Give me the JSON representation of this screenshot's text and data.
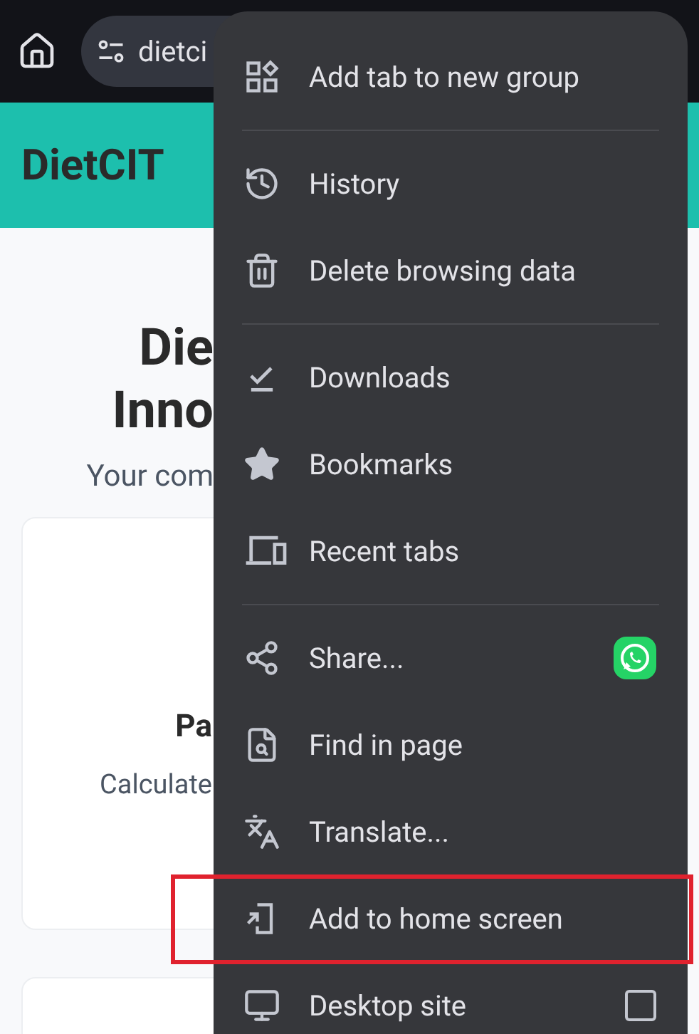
{
  "browser_bar": {
    "url": "dietci"
  },
  "site_header": {
    "title": "DietCIT"
  },
  "page": {
    "heading_lines": [
      "Die",
      "Inno"
    ],
    "subtitle": "Your com",
    "card": {
      "title": "Pa",
      "text": "Calculate"
    }
  },
  "menu": {
    "groups": [
      [
        {
          "kind": "group",
          "label": "Add tab to new group",
          "highlighted": false
        }
      ],
      [
        {
          "kind": "history",
          "label": "History",
          "highlighted": false
        },
        {
          "kind": "delete",
          "label": "Delete browsing data",
          "highlighted": false
        }
      ],
      [
        {
          "kind": "downloads",
          "label": "Downloads",
          "highlighted": false
        },
        {
          "kind": "bookmarks",
          "label": "Bookmarks",
          "highlighted": false
        },
        {
          "kind": "recent",
          "label": "Recent tabs",
          "highlighted": false
        }
      ],
      [
        {
          "kind": "share",
          "label": "Share...",
          "highlighted": false
        },
        {
          "kind": "find",
          "label": "Find in page",
          "highlighted": false
        },
        {
          "kind": "translate",
          "label": "Translate...",
          "highlighted": false
        },
        {
          "kind": "home",
          "label": "Add to home screen",
          "highlighted": true
        },
        {
          "kind": "desktop",
          "label": "Desktop site",
          "highlighted": false,
          "checked": false
        }
      ]
    ]
  }
}
